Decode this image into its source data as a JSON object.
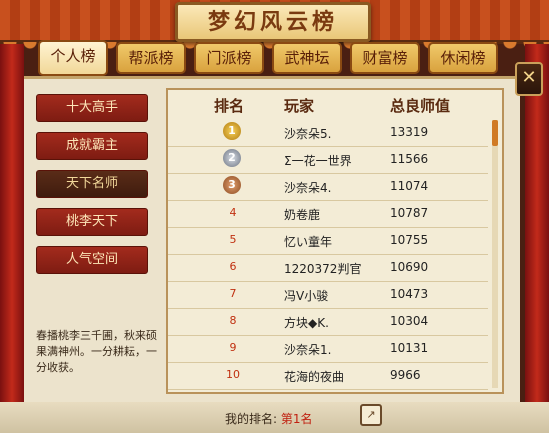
{
  "title": "梦幻风云榜",
  "tabs": [
    "个人榜",
    "帮派榜",
    "门派榜",
    "武神坛",
    "财富榜",
    "休闲榜"
  ],
  "side_menu": [
    "十大高手",
    "成就霸主",
    "天下名师",
    "桃李天下",
    "人气空间"
  ],
  "quote": "春播桃李三千圃，秋来硕果满神州。一分耕耘，一分收获。",
  "columns": [
    "排名",
    "玩家",
    "总良师值"
  ],
  "rows": [
    {
      "rank": "1",
      "player": "沙奈朵5.",
      "value": "13319"
    },
    {
      "rank": "2",
      "player": "Σ一花一世界",
      "value": "11566"
    },
    {
      "rank": "3",
      "player": "沙奈朵4.",
      "value": "11074"
    },
    {
      "rank": "4",
      "player": "奶卷鹿",
      "value": "10787"
    },
    {
      "rank": "5",
      "player": "忆い童年",
      "value": "10755"
    },
    {
      "rank": "6",
      "player": "1220372判官",
      "value": "10690"
    },
    {
      "rank": "7",
      "player": "冯V小骏",
      "value": "10473"
    },
    {
      "rank": "8",
      "player": "方块◆K.",
      "value": "10304"
    },
    {
      "rank": "9",
      "player": "沙奈朵1.",
      "value": "10131"
    },
    {
      "rank": "10",
      "player": "花海的夜曲",
      "value": "9966"
    }
  ],
  "my_rank_label": "我的排名:",
  "my_rank_value": "第1名",
  "colors": {
    "accent": "#c02010",
    "tab_active": "#fff4d2"
  }
}
